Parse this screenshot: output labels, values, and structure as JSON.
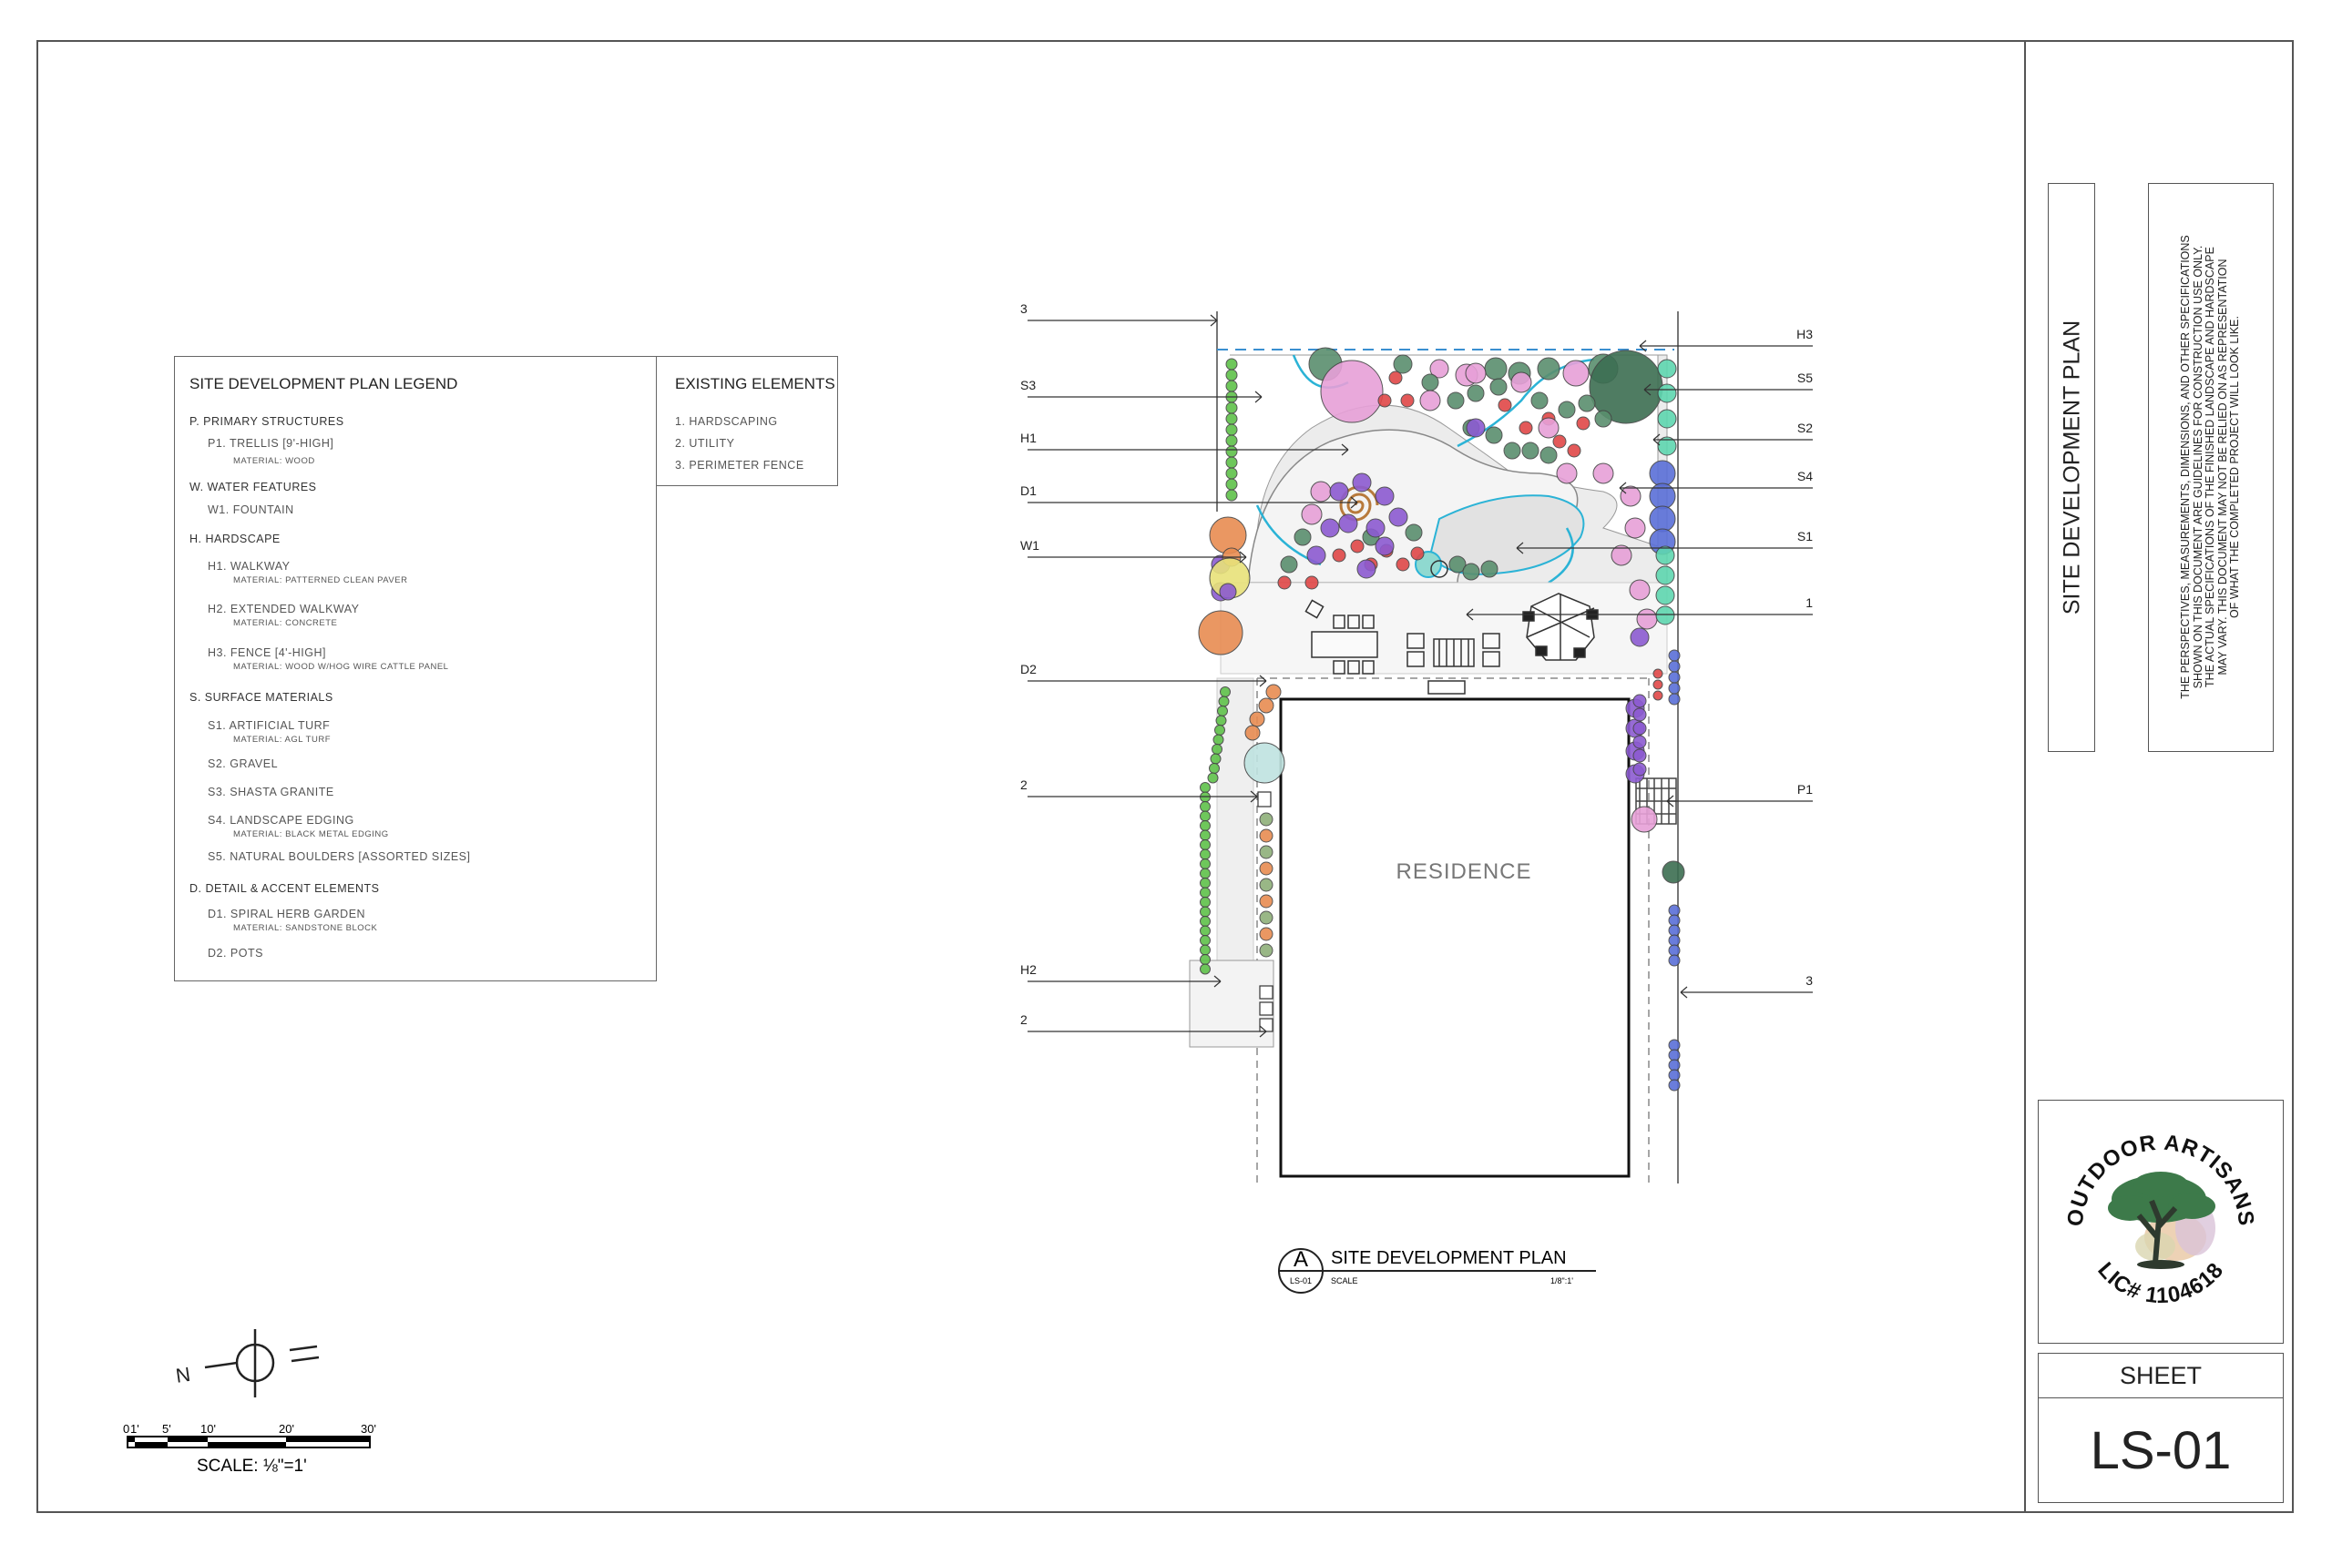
{
  "legend": {
    "title": "SITE DEVELOPMENT PLAN LEGEND",
    "sections": [
      {
        "heading": "P. PRIMARY STRUCTURES",
        "items": [
          {
            "label": "P1. TRELLIS [9'-HIGH]",
            "material": "MATERIAL: WOOD"
          }
        ]
      },
      {
        "heading": "W. WATER FEATURES",
        "items": [
          {
            "label": "W1. FOUNTAIN",
            "material": ""
          }
        ]
      },
      {
        "heading": "H. HARDSCAPE",
        "items": [
          {
            "label": "H1. WALKWAY",
            "material": "MATERIAL: PATTERNED CLEAN PAVER"
          },
          {
            "label": "H2. EXTENDED WALKWAY",
            "material": "MATERIAL: CONCRETE"
          },
          {
            "label": "H3. FENCE [4'-HIGH]",
            "material": "MATERIAL: WOOD W/HOG WIRE CATTLE PANEL"
          }
        ]
      },
      {
        "heading": "S. SURFACE MATERIALS",
        "items": [
          {
            "label": "S1. ARTIFICIAL TURF",
            "material": "MATERIAL: AGL TURF"
          },
          {
            "label": "S2. GRAVEL",
            "material": ""
          },
          {
            "label": "S3. SHASTA GRANITE",
            "material": ""
          },
          {
            "label": "S4. LANDSCAPE EDGING",
            "material": "MATERIAL: BLACK METAL EDGING"
          },
          {
            "label": "S5. NATURAL BOULDERS [ASSORTED SIZES]",
            "material": ""
          }
        ]
      },
      {
        "heading": "D. DETAIL & ACCENT ELEMENTS",
        "items": [
          {
            "label": "D1. SPIRAL HERB GARDEN",
            "material": "MATERIAL: SANDSTONE BLOCK"
          },
          {
            "label": "D2. POTS",
            "material": ""
          }
        ]
      }
    ]
  },
  "existing": {
    "title": "EXISTING ELEMENTS",
    "items": [
      "1. HARDSCAPING",
      "2. UTILITY",
      "3. PERIMETER FENCE"
    ]
  },
  "plan": {
    "residence_label": "RESIDENCE",
    "callouts_left": [
      "3",
      "S3",
      "H1",
      "D1",
      "W1",
      "D2",
      "2",
      "H2",
      "2"
    ],
    "callouts_right": [
      "H3",
      "S5",
      "S2",
      "S4",
      "S1",
      "1",
      "P1",
      "3"
    ],
    "colors": {
      "turf": "#c8e6c0",
      "green_tree": "#5a8f6e",
      "pink": "#e7a0d8",
      "purple": "#8c5bd1",
      "red": "#e04848",
      "orange": "#e88c52",
      "blue": "#5a6fd8",
      "teal": "#5fd6b0",
      "edging": "#2bb3d6"
    }
  },
  "detail_tag": {
    "letter": "A",
    "sheet": "LS-01",
    "title": "SITE DEVELOPMENT PLAN",
    "scale_label": "SCALE",
    "scale_value": "1/8\":1'"
  },
  "scale_bar": {
    "ticks": [
      "0",
      "1'",
      "5'",
      "10'",
      "20'",
      "30'"
    ],
    "label": "SCALE: ⅛\"=1'"
  },
  "titleblock": {
    "sheet_title": "SITE DEVELOPMENT PLAN",
    "note_lines": [
      "THE PERSPECTIVES, MEASUREMENTS, DIMENSIONS, AND OTHER SPECIFICATIONS",
      "SHOWN ON THIS DOCUMENT ARE GUIDELINES FOR CONSTRUCTION USE ONLY.",
      "THE ACTUAL SPECIFICATIONS OF THE FINISHED LANDSCAPE AND HARDSCAPE",
      "MAY VARY. THIS DOCUMENT MAY NOT BE RELIED ON AS REPRESENTATION",
      "OF WHAT THE COMPLETED PROJECT WILL LOOK LIKE."
    ],
    "logo_top": "OUTDOOR ARTISANS",
    "logo_bottom": "LIC# 1104618",
    "sheet_label": "SHEET",
    "sheet_number": "LS-01"
  }
}
